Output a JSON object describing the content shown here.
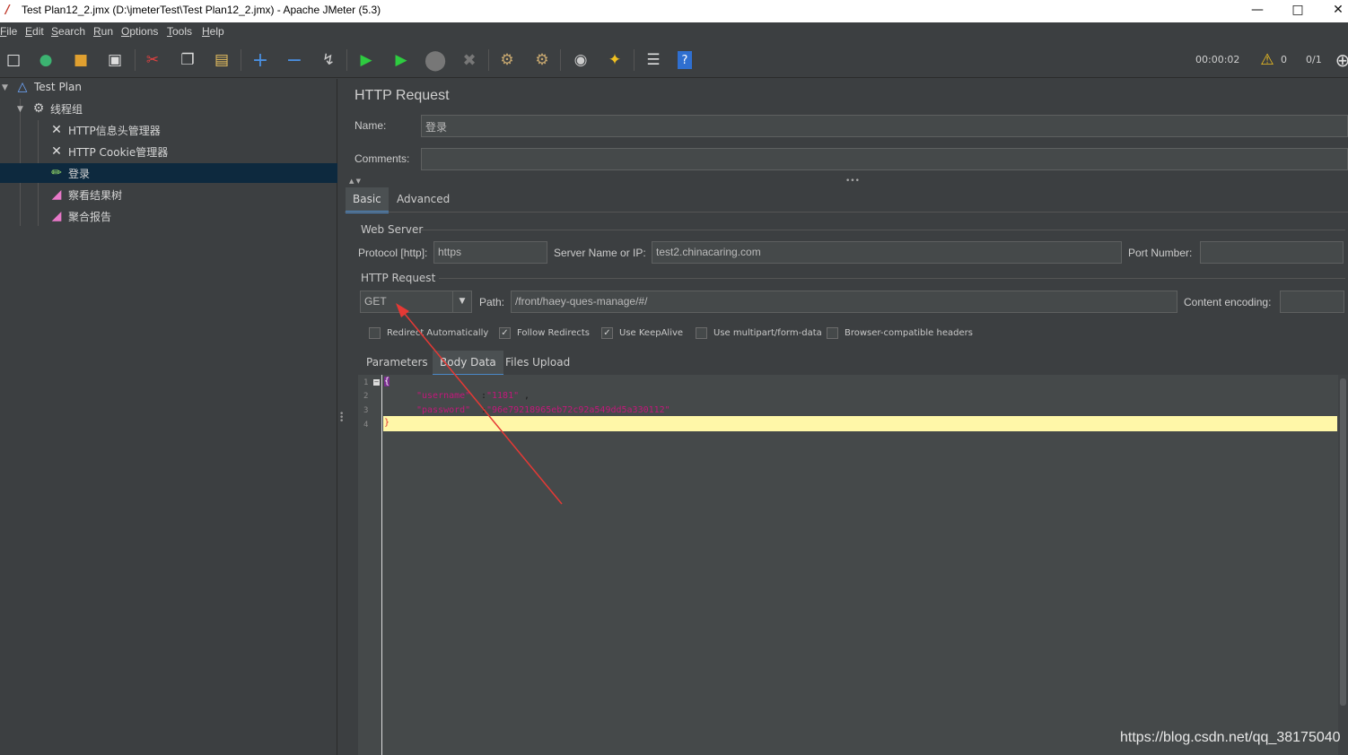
{
  "window": {
    "title": "Test Plan12_2.jmx (D:\\jmeterTest\\Test Plan12_2.jmx) - Apache JMeter (5.3)"
  },
  "menu": [
    "File",
    "Edit",
    "Search",
    "Run",
    "Options",
    "Tools",
    "Help"
  ],
  "toolbar": {
    "elapsed": "00:00:02",
    "warnings": "0",
    "threads": "0/1",
    "icons": [
      "new-icon",
      "templates-icon",
      "open-icon",
      "save-icon",
      "cut-icon",
      "copy-icon",
      "paste-icon",
      "expand-icon",
      "collapse-icon",
      "toggle-icon",
      "start-icon",
      "start-no-pause-icon",
      "stop-icon",
      "shutdown-icon",
      "clear-icon",
      "clear-all-icon",
      "search-icon",
      "reset-search-icon",
      "function-helper-icon",
      "help-icon",
      "warning-icon",
      "remote-icon"
    ]
  },
  "tree": {
    "items": [
      {
        "label": "Test Plan",
        "icon": "flask-icon"
      },
      {
        "label": "线程组",
        "icon": "gear-icon"
      },
      {
        "label": "HTTP信息头管理器",
        "icon": "tools-icon"
      },
      {
        "label": "HTTP Cookie管理器",
        "icon": "tools-icon"
      },
      {
        "label": "登录",
        "icon": "pipette-icon",
        "selected": true
      },
      {
        "label": "察看结果树",
        "icon": "chart-icon"
      },
      {
        "label": "聚合报告",
        "icon": "chart-icon"
      }
    ]
  },
  "panel": {
    "title": "HTTP Request",
    "name_label": "Name:",
    "name_value": "登录",
    "comments_label": "Comments:",
    "comments_value": "",
    "tabs": [
      "Basic",
      "Advanced"
    ],
    "active_tab": "Basic",
    "web_server": {
      "group_label": "Web Server",
      "protocol_label": "Protocol [http]:",
      "protocol_value": "https",
      "server_label": "Server Name or IP:",
      "server_value": "test2.chinacaring.com",
      "port_label": "Port Number:",
      "port_value": ""
    },
    "http_request": {
      "group_label": "HTTP Request",
      "method": "GET",
      "path_label": "Path:",
      "path_value": "/front/haey-ques-manage/#/",
      "encoding_label": "Content encoding:",
      "encoding_value": ""
    },
    "options": [
      {
        "label": "Redirect Automatically",
        "checked": false
      },
      {
        "label": "Follow Redirects",
        "checked": true
      },
      {
        "label": "Use KeepAlive",
        "checked": true
      },
      {
        "label": "Use multipart/form-data",
        "checked": false
      },
      {
        "label": "Browser-compatible headers",
        "checked": false
      }
    ],
    "subtabs": [
      "Parameters",
      "Body Data",
      "Files Upload"
    ],
    "active_subtab": "Body Data",
    "body": {
      "line_numbers": [
        "1",
        "2",
        "3",
        "4"
      ],
      "open_brace": "{",
      "key1": "\"username\"",
      "colon": ":",
      "val1": "\"1181\"",
      "comma": ",",
      "key2": "\"password\"",
      "val2": "\"96e79218965eb72c92a549dd5a330112\"",
      "close_brace": "}"
    }
  },
  "watermark": "https://blog.csdn.net/qq_38175040",
  "colors": {
    "background": "#3c3f41",
    "selection": "#0d293e",
    "accent": "#4a88c7",
    "string": "#c2187b",
    "highlight_line": "#fff7a8",
    "annotation_arrow": "#e53935"
  }
}
